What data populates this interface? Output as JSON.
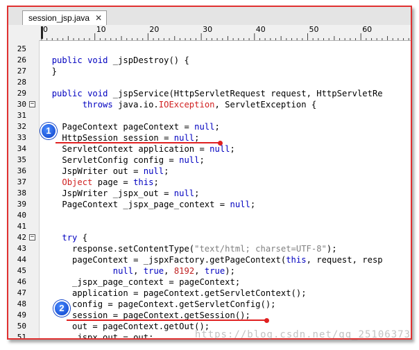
{
  "tab": {
    "title": "session_jsp.java",
    "close_glyph": "✕"
  },
  "ruler": {
    "labels": [
      "0",
      "10",
      "20",
      "30",
      "40",
      "50",
      "60"
    ]
  },
  "code": [
    {
      "n": "25",
      "fold": "",
      "segs": []
    },
    {
      "n": "26",
      "fold": "",
      "segs": [
        {
          "t": "  "
        },
        {
          "t": "public",
          "c": "kw"
        },
        {
          "t": " "
        },
        {
          "t": "void",
          "c": "kw"
        },
        {
          "t": " _jspDestroy() {"
        }
      ]
    },
    {
      "n": "27",
      "fold": "",
      "segs": [
        {
          "t": "  }"
        }
      ]
    },
    {
      "n": "28",
      "fold": "",
      "segs": []
    },
    {
      "n": "29",
      "fold": "",
      "segs": [
        {
          "t": "  "
        },
        {
          "t": "public",
          "c": "kw"
        },
        {
          "t": " "
        },
        {
          "t": "void",
          "c": "kw"
        },
        {
          "t": " _jspService(HttpServletRequest request, HttpServletRe"
        }
      ]
    },
    {
      "n": "30",
      "fold": "−",
      "segs": [
        {
          "t": "        "
        },
        {
          "t": "throws",
          "c": "kw"
        },
        {
          "t": " java.io."
        },
        {
          "t": "IOException",
          "c": "ex"
        },
        {
          "t": ", ServletException {"
        }
      ]
    },
    {
      "n": "31",
      "fold": "",
      "segs": []
    },
    {
      "n": "32",
      "fold": "",
      "segs": [
        {
          "t": "    PageContext pageContext = "
        },
        {
          "t": "null",
          "c": "kw"
        },
        {
          "t": ";"
        }
      ]
    },
    {
      "n": "33",
      "fold": "",
      "segs": [
        {
          "t": "    HttpSession session = "
        },
        {
          "t": "null",
          "c": "kw"
        },
        {
          "t": ";"
        }
      ]
    },
    {
      "n": "34",
      "fold": "",
      "segs": [
        {
          "t": "    ServletContext application = "
        },
        {
          "t": "null",
          "c": "kw"
        },
        {
          "t": ";"
        }
      ]
    },
    {
      "n": "35",
      "fold": "",
      "segs": [
        {
          "t": "    ServletConfig config = "
        },
        {
          "t": "null",
          "c": "kw"
        },
        {
          "t": ";"
        }
      ]
    },
    {
      "n": "36",
      "fold": "",
      "segs": [
        {
          "t": "    JspWriter out = "
        },
        {
          "t": "null",
          "c": "kw"
        },
        {
          "t": ";"
        }
      ]
    },
    {
      "n": "37",
      "fold": "",
      "segs": [
        {
          "t": "    "
        },
        {
          "t": "Object",
          "c": "ex"
        },
        {
          "t": " page = "
        },
        {
          "t": "this",
          "c": "kw"
        },
        {
          "t": ";"
        }
      ]
    },
    {
      "n": "38",
      "fold": "",
      "segs": [
        {
          "t": "    JspWriter _jspx_out = "
        },
        {
          "t": "null",
          "c": "kw"
        },
        {
          "t": ";"
        }
      ]
    },
    {
      "n": "39",
      "fold": "",
      "segs": [
        {
          "t": "    PageContext _jspx_page_context = "
        },
        {
          "t": "null",
          "c": "kw"
        },
        {
          "t": ";"
        }
      ]
    },
    {
      "n": "40",
      "fold": "",
      "segs": []
    },
    {
      "n": "41",
      "fold": "",
      "segs": []
    },
    {
      "n": "42",
      "fold": "−",
      "segs": [
        {
          "t": "    "
        },
        {
          "t": "try",
          "c": "kw"
        },
        {
          "t": " {"
        }
      ]
    },
    {
      "n": "43",
      "fold": "",
      "segs": [
        {
          "t": "      response.setContentType("
        },
        {
          "t": "\"text/html; charset=UTF-8\"",
          "c": "str"
        },
        {
          "t": ");"
        }
      ]
    },
    {
      "n": "44",
      "fold": "",
      "segs": [
        {
          "t": "      pageContext = _jspxFactory.getPageContext("
        },
        {
          "t": "this",
          "c": "kw"
        },
        {
          "t": ", request, resp"
        }
      ]
    },
    {
      "n": "45",
      "fold": "",
      "segs": [
        {
          "t": "              "
        },
        {
          "t": "null",
          "c": "kw"
        },
        {
          "t": ", "
        },
        {
          "t": "true",
          "c": "kw"
        },
        {
          "t": ", "
        },
        {
          "t": "8192",
          "c": "num"
        },
        {
          "t": ", "
        },
        {
          "t": "true",
          "c": "kw"
        },
        {
          "t": ");"
        }
      ]
    },
    {
      "n": "46",
      "fold": "",
      "segs": [
        {
          "t": "      _jspx_page_context = pageContext;"
        }
      ]
    },
    {
      "n": "47",
      "fold": "",
      "segs": [
        {
          "t": "      application = pageContext.getServletContext();"
        }
      ]
    },
    {
      "n": "48",
      "fold": "",
      "segs": [
        {
          "t": "      config = pageContext.getServletConfig();"
        }
      ]
    },
    {
      "n": "49",
      "fold": "",
      "segs": [
        {
          "t": "      session = pageContext.getSession();"
        }
      ]
    },
    {
      "n": "50",
      "fold": "",
      "segs": [
        {
          "t": "      out = pageContext.getOut();"
        }
      ]
    },
    {
      "n": "51",
      "fold": "",
      "segs": [
        {
          "t": "      _jspx_out = out;"
        }
      ]
    }
  ],
  "annotations": [
    {
      "label": "1",
      "color": "#e02020"
    },
    {
      "label": "2",
      "color": "#e02020"
    }
  ],
  "watermark": "https://blog.csdn.net/qq_25106373"
}
